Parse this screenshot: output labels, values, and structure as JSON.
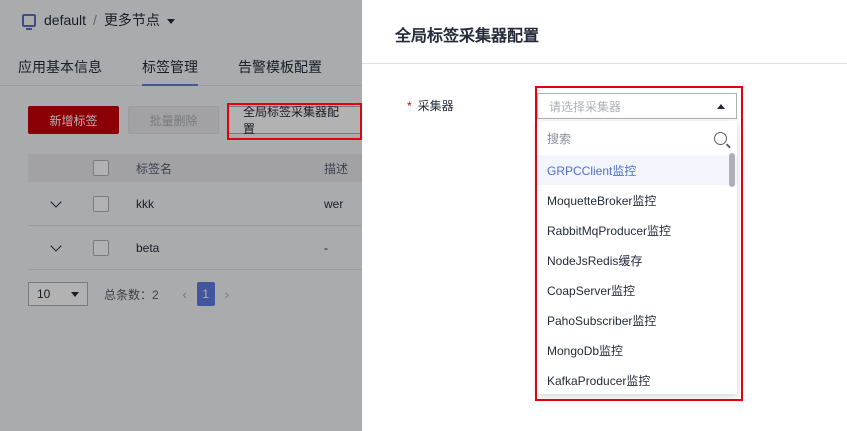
{
  "header": {
    "project": "default",
    "separator": "/",
    "more_nodes": "更多节点"
  },
  "tabs": [
    {
      "label": "应用基本信息"
    },
    {
      "label": "标签管理"
    },
    {
      "label": "告警模板配置"
    }
  ],
  "toolbar": {
    "add_label": "新增标签",
    "batch_delete_label": "批量删除",
    "global_config_label": "全局标签采集器配置"
  },
  "table": {
    "headers": {
      "name": "标签名",
      "desc": "描述"
    },
    "rows": [
      {
        "name": "kkk",
        "desc": "wer"
      },
      {
        "name": "beta",
        "desc": "-"
      }
    ]
  },
  "pagination": {
    "page_size": "10",
    "total_text": "总条数：2",
    "prev": "‹",
    "current_page": "1",
    "next": "›"
  },
  "drawer": {
    "title": "全局标签采集器配置",
    "field_required_mark": "*",
    "field_label": "采集器",
    "select_placeholder": "请选择采集器",
    "search_placeholder": "搜索",
    "options": [
      {
        "label": "GRPCClient监控"
      },
      {
        "label": "MoquetteBroker监控"
      },
      {
        "label": "RabbitMqProducer监控"
      },
      {
        "label": "NodeJsRedis缓存"
      },
      {
        "label": "CoapServer监控"
      },
      {
        "label": "PahoSubscriber监控"
      },
      {
        "label": "MongoDb监控"
      },
      {
        "label": "KafkaProducer监控"
      }
    ]
  },
  "colors": {
    "primary_red": "#c7000b",
    "accent_blue": "#5e7ce0",
    "highlight_box": "#e3000f"
  }
}
